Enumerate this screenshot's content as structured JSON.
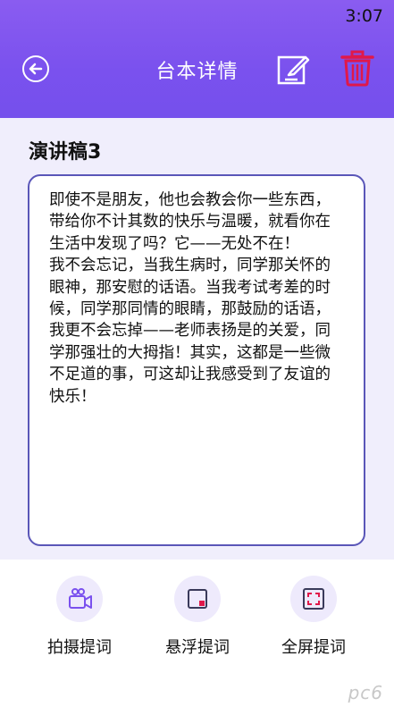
{
  "status_bar": {
    "time": "3:07"
  },
  "header": {
    "title": "台本详情"
  },
  "document": {
    "title": "演讲稿3",
    "body": "即使不是朋友，他也会教会你一些东西，带给你不计其数的快乐与温暖，就看你在生活中发现了吗？它——无处不在！　　我不会忘记，当我生病时，同学那关怀的眼神，那安慰的话语。当我考试考差的时候，同学那同情的眼睛，那鼓励的话语，我更不会忘掉——老师表扬是的关爱，同学那强壮的大拇指！其实，这都是一些微不足道的事，可这却让我感受到了友谊的快乐！"
  },
  "actions": [
    {
      "label": "拍摄提词",
      "icon": "video-camera-icon"
    },
    {
      "label": "悬浮提词",
      "icon": "floating-window-icon"
    },
    {
      "label": "全屏提词",
      "icon": "fullscreen-icon"
    }
  ],
  "watermark": "pc6",
  "colors": {
    "accent": "#7a51ee",
    "delete": "#e0184a",
    "border": "#5a56b8"
  }
}
